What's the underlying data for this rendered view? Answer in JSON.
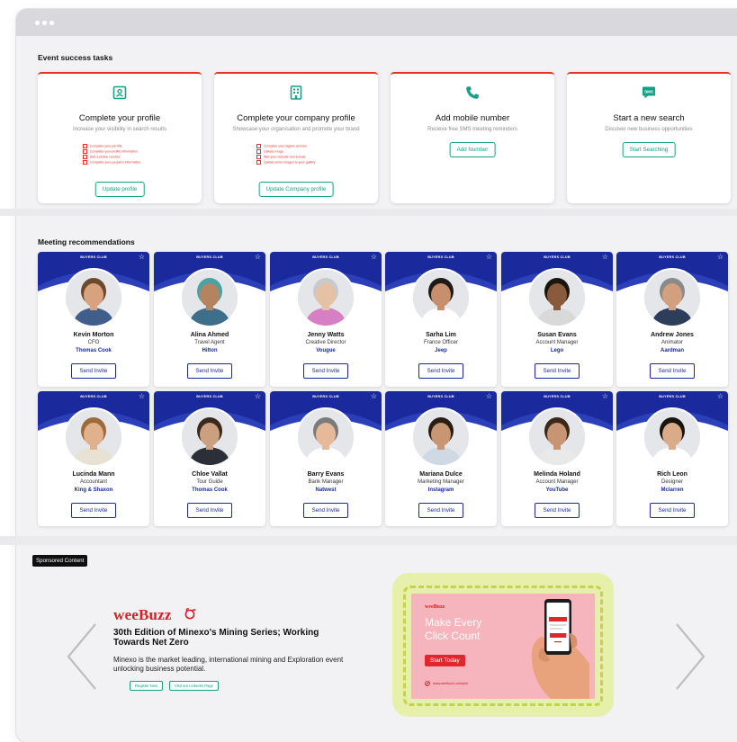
{
  "sections": {
    "tasks_title": "Event success tasks",
    "meetings_title": "Meeting recommendations"
  },
  "tasks": [
    {
      "icon": "profile-card-icon",
      "title": "Complete your profile",
      "subtitle": "Increase your visibility in search results",
      "checklist": [
        "Complete your job title",
        "Complete your profile information",
        "Add a phone number",
        "Complete your people's information"
      ],
      "button": "Update profile"
    },
    {
      "icon": "building-icon",
      "title": "Complete your company profile",
      "subtitle": "Showcase your organisation and promote your brand",
      "checklist": [
        "Complete your tagline and bio",
        "Upload a logo",
        "Add your website and socials",
        "Upload some images to your gallery"
      ],
      "button": "Update Company profile"
    },
    {
      "icon": "phone-icon",
      "title": "Add mobile number",
      "subtitle": "Recieve free SMS meeting reminders",
      "checklist": [],
      "button": "Add Number"
    },
    {
      "icon": "sms-icon",
      "title": "Start a new search",
      "subtitle": "Discover new business opportunities",
      "checklist": [],
      "button": "Start Searching"
    }
  ],
  "people_card": {
    "club_label": "BUYERS CLUB",
    "invite_label": "Send Invite",
    "star_icon": "star-outline-icon",
    "banner_color": "#1a2a9c"
  },
  "people": [
    {
      "name": "Kevin Morton",
      "role": "CFO",
      "company": "Thomas Cook"
    },
    {
      "name": "Alina Ahmed",
      "role": "Travel Agent",
      "company": "Hilton"
    },
    {
      "name": "Jenny Watts",
      "role": "Creative Director",
      "company": "Vougue"
    },
    {
      "name": "Sarha Lim",
      "role": "France Officer",
      "company": "Jeep"
    },
    {
      "name": "Susan Evans",
      "role": "Account Manager",
      "company": "Lego"
    },
    {
      "name": "Andrew Jones",
      "role": "Animator",
      "company": "Aardman"
    },
    {
      "name": "Lucinda Mann",
      "role": "Accountant",
      "company": "King & Shaxon"
    },
    {
      "name": "Chloe Vallat",
      "role": "Tour Guide",
      "company": "Thomas Cook"
    },
    {
      "name": "Barry Evans",
      "role": "Bank Manager",
      "company": "Natwest"
    },
    {
      "name": "Mariana Dulce",
      "role": "Marketing Manager",
      "company": "Instagram"
    },
    {
      "name": "Melinda Holand",
      "role": "Account Manager",
      "company": "YouTube"
    },
    {
      "name": "Rich Leon",
      "role": "Designer",
      "company": "Mclarren"
    }
  ],
  "sponsored": {
    "tag": "Sponsored Content",
    "logo": "weeBuzz",
    "headline": "30th Edition of Minexo's Mining Series; Working Towards Net Zero",
    "description": "Minexo is the market leading, international mining and Exploration event unlocking business potential.",
    "buttons": [
      "Register Now",
      "Visit our LinkedIn Page"
    ],
    "ad": {
      "logo": "weeBuzz",
      "headline": "Make Every Click Count",
      "cta": "Start Today",
      "site": "www.weebuzz.com/join"
    }
  },
  "colors": {
    "accent_teal": "#16a085",
    "task_top_border": "#e4332b",
    "navy": "#1a2a9c",
    "brand_red": "#d81f26"
  }
}
